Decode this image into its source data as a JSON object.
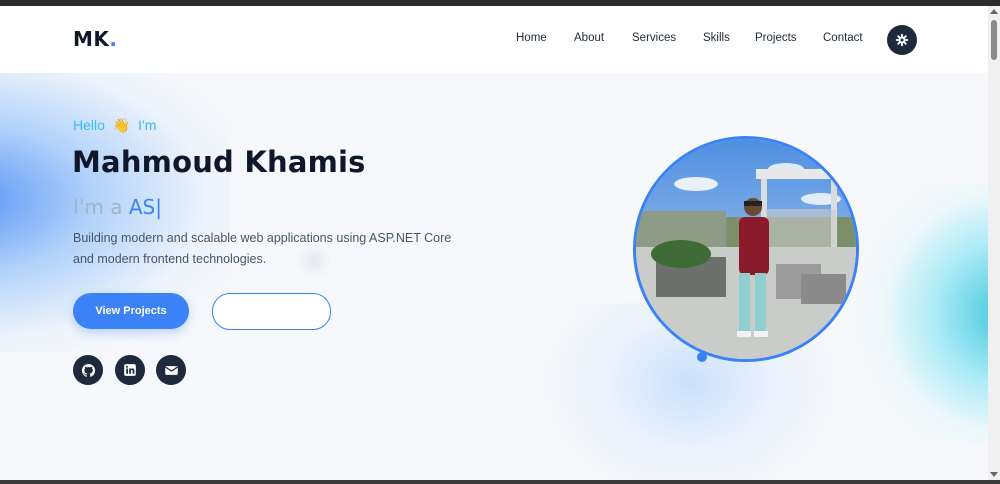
{
  "brand": {
    "logo_text": "MK",
    "logo_dot": "."
  },
  "nav": {
    "items": [
      {
        "label": "Home"
      },
      {
        "label": "About"
      },
      {
        "label": "Services"
      },
      {
        "label": "Skills"
      },
      {
        "label": "Projects"
      },
      {
        "label": "Contact"
      }
    ],
    "theme_toggle_icon": "gear-icon"
  },
  "hero": {
    "greeting": "Hello",
    "greeting_emoji": "👋",
    "greeting_suffix": "I'm",
    "name": "Mahmoud Khamis",
    "typed_prefix": "I'm a",
    "typed_word": "AS",
    "typed_cursor": "|",
    "description": "Building modern and scalable web applications using ASP.NET Core and modern frontend technologies.",
    "primary_button": "View Projects",
    "secondary_button": "",
    "socials": [
      {
        "icon": "github-icon"
      },
      {
        "icon": "linkedin-icon"
      },
      {
        "icon": "email-icon"
      }
    ]
  },
  "colors": {
    "accent": "#3b82f6",
    "dark": "#1e293b",
    "greeting": "#38bdf8",
    "cyan_glow": "#06b6d4"
  }
}
